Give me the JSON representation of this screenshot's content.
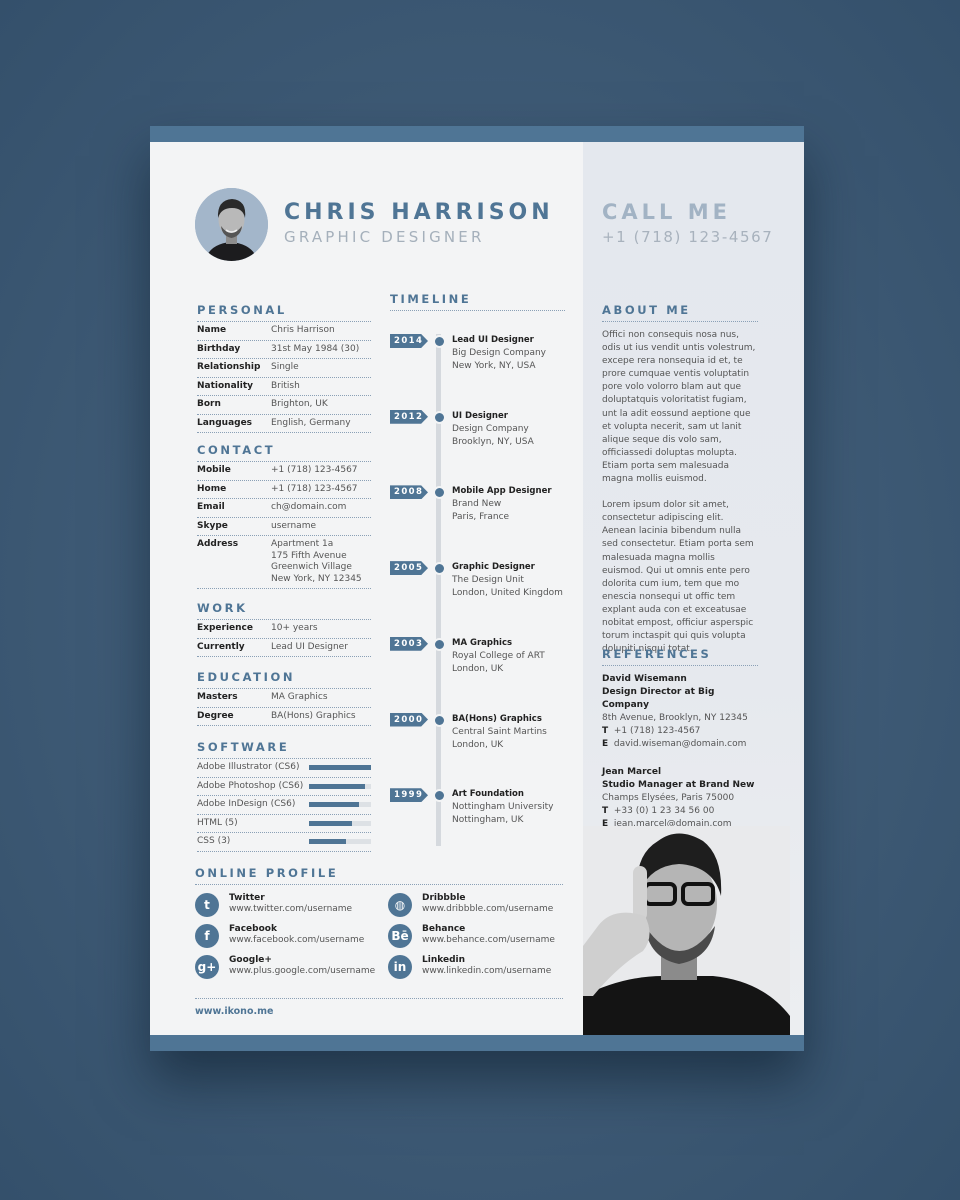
{
  "header": {
    "name": "CHRIS HARRISON",
    "title": "GRAPHIC DESIGNER",
    "call_label": "CALL ME",
    "phone": "+1 (718) 123-4567"
  },
  "personal": {
    "heading": "PERSONAL",
    "rows": [
      {
        "key": "Name",
        "value": "Chris Harrison"
      },
      {
        "key": "Birthday",
        "value": "31st May 1984 (30)"
      },
      {
        "key": "Relationship",
        "value": "Single"
      },
      {
        "key": "Nationality",
        "value": "British"
      },
      {
        "key": "Born",
        "value": "Brighton, UK"
      },
      {
        "key": "Languages",
        "value": "English, Germany"
      }
    ]
  },
  "contact": {
    "heading": "CONTACT",
    "rows": [
      {
        "key": "Mobile",
        "value": "+1 (718) 123-4567"
      },
      {
        "key": "Home",
        "value": "+1 (718) 123-4567"
      },
      {
        "key": "Email",
        "value": "ch@domain.com"
      },
      {
        "key": "Skype",
        "value": "username"
      },
      {
        "key": "Address",
        "value": "Apartment 1a\n175 Fifth Avenue\nGreenwich Village\nNew York, NY 12345"
      }
    ]
  },
  "work": {
    "heading": "WORK",
    "rows": [
      {
        "key": "Experience",
        "value": "10+ years"
      },
      {
        "key": "Currently",
        "value": "Lead UI Designer"
      }
    ]
  },
  "education": {
    "heading": "EDUCATION",
    "rows": [
      {
        "key": "Masters",
        "value": "MA Graphics"
      },
      {
        "key": "Degree",
        "value": "BA(Hons) Graphics"
      }
    ]
  },
  "software": {
    "heading": "SOFTWARE",
    "items": [
      {
        "label": "Adobe Illustrator (CS6)",
        "level": 1.0
      },
      {
        "label": "Adobe Photoshop (CS6)",
        "level": 0.9
      },
      {
        "label": "Adobe InDesign (CS6)",
        "level": 0.8
      },
      {
        "label": "HTML (5)",
        "level": 0.7
      },
      {
        "label": "CSS (3)",
        "level": 0.6
      }
    ]
  },
  "timeline": {
    "heading": "TIMELINE",
    "items": [
      {
        "year": "2014",
        "role": "Lead UI Designer",
        "org": "Big Design Company",
        "place": "New York, NY, USA"
      },
      {
        "year": "2012",
        "role": "UI Designer",
        "org": "Design Company",
        "place": "Brooklyn, NY, USA"
      },
      {
        "year": "2008",
        "role": "Mobile App Designer",
        "org": "Brand New",
        "place": "Paris, France"
      },
      {
        "year": "2005",
        "role": "Graphic Designer",
        "org": "The Design Unit",
        "place": "London, United Kingdom"
      },
      {
        "year": "2003",
        "role": "MA Graphics",
        "org": "Royal College of ART",
        "place": "London, UK"
      },
      {
        "year": "2000",
        "role": "BA(Hons) Graphics",
        "org": "Central Saint Martins",
        "place": "London, UK"
      },
      {
        "year": "1999",
        "role": "Art Foundation",
        "org": "Nottingham University",
        "place": "Nottingham, UK"
      }
    ]
  },
  "about": {
    "heading": "ABOUT ME",
    "paragraphs": [
      "Offici non consequis nosa nus, odis ut ius vendit untis volestrum, excepe rera nonsequia id et, te prore cumquae ventis voluptatin pore volo volorro blam aut que doluptatquis voloritatist fugiam, unt la adit eossund aeptione que et volupta necerit, sam ut lanit alique seque dis volo sam, officiassedi doluptas molupta. Etiam porta sem malesuada magna mollis euismod.",
      "Lorem ipsum dolor sit amet, consectetur adipiscing elit. Aenean lacinia bibendum nulla sed consectetur. Etiam porta sem malesuada magna mollis euismod. Qui ut omnis ente pero dolorita cum ium, tem que mo enescia nonsequi ut offic tem explant auda con et exceatusae nobitat empost, officiur asperspic torum inctaspit qui quis volupta dolupiti nisqui totat."
    ]
  },
  "references": {
    "heading": "REFERENCES",
    "items": [
      {
        "name": "David Wisemann",
        "position": "Design Director at Big Company",
        "address": "8th Avenue, Brooklyn, NY 12345",
        "t_label": "T",
        "phone": "+1 (718) 123-4567",
        "e_label": "E",
        "email": "david.wiseman@domain.com"
      },
      {
        "name": "Jean Marcel",
        "position": "Studio Manager at Brand New",
        "address": "Champs Elysées, Paris 75000",
        "t_label": "T",
        "phone": "+33 (0) 1 23 34 56 00",
        "e_label": "E",
        "email": "jean.marcel@domain.com"
      }
    ]
  },
  "online_profile": {
    "heading": "ONLINE PROFILE",
    "items": [
      {
        "name": "Twitter",
        "url": "www.twitter.com/username",
        "icon": "twitter-icon",
        "glyph": "t"
      },
      {
        "name": "Facebook",
        "url": "www.facebook.com/username",
        "icon": "facebook-icon",
        "glyph": "f"
      },
      {
        "name": "Google+",
        "url": "www.plus.google.com/username",
        "icon": "google-plus-icon",
        "glyph": "g+"
      },
      {
        "name": "Dribbble",
        "url": "www.dribbble.com/username",
        "icon": "dribbble-icon",
        "glyph": "◍"
      },
      {
        "name": "Behance",
        "url": "www.behance.com/username",
        "icon": "behance-icon",
        "glyph": "Bē"
      },
      {
        "name": "Linkedin",
        "url": "www.linkedin.com/username",
        "icon": "linkedin-icon",
        "glyph": "in"
      }
    ]
  },
  "footer": {
    "website": "www.ikono.me"
  },
  "colors": {
    "accent": "#4f7595",
    "background": "#3e5a75"
  }
}
